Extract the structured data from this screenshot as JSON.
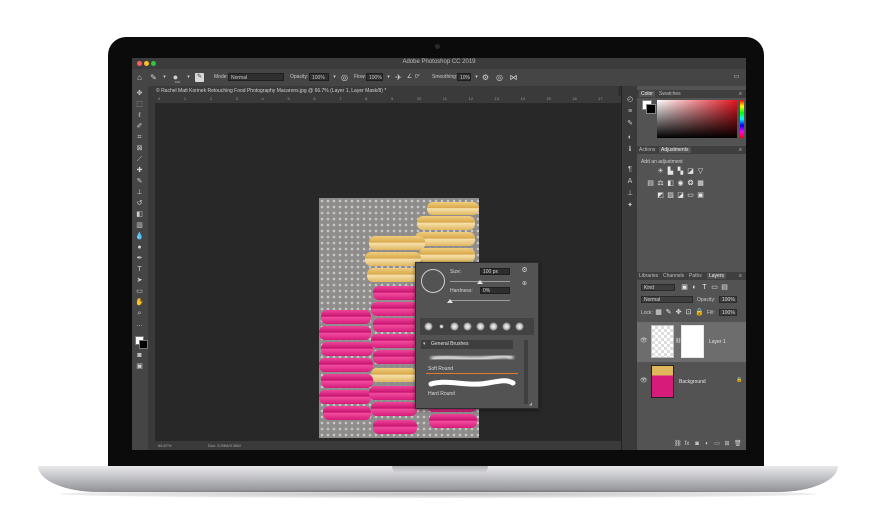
{
  "window": {
    "title": "Adobe Photoshop CC 2019"
  },
  "options_bar": {
    "brush_size": "100",
    "mode_label": "Mode:",
    "mode_value": "Normal",
    "opacity_label": "Opacity:",
    "opacity_value": "100%",
    "flow_label": "Flow:",
    "flow_value": "100%",
    "angle_value": "0°",
    "smoothing_label": "Smoothing:",
    "smoothing_value": "10%"
  },
  "document": {
    "tab_title": "© Rachel Matt Korinek Retouching Food Photography Macarons.jpg @ 66.7% (Layer 1, Layer Mask/8) *"
  },
  "ruler": {
    "ticks": [
      "0",
      "1",
      "2",
      "3",
      "4",
      "5",
      "6",
      "7",
      "8",
      "9",
      "10",
      "11",
      "12",
      "13",
      "14",
      "15",
      "16",
      "17"
    ]
  },
  "status": {
    "zoom": "66.67%",
    "doc": "Doc: 5.93M/9.35M"
  },
  "brush_popup": {
    "size_label": "Size:",
    "size_value": "100 px",
    "hardness_label": "Hardness:",
    "hardness_value": "0%",
    "folder": "General Brushes",
    "brushes": [
      "Soft Round",
      "Hard Round"
    ],
    "size_fraction": 0.5,
    "hardness_fraction": 0.0
  },
  "color_panel": {
    "tabs": [
      "Color",
      "Swatches"
    ],
    "active": "Color",
    "hue_color": "#e1141e"
  },
  "adjustments_panel": {
    "tabs": [
      "Actions",
      "Adjustments"
    ],
    "active": "Adjustments",
    "hint": "Add an adjustment"
  },
  "layers_panel": {
    "tabs": [
      "Libraries",
      "Channels",
      "Paths",
      "Layers"
    ],
    "active": "Layers",
    "filter": "Kind",
    "blend_mode": "Normal",
    "opacity_label": "Opacity:",
    "opacity_value": "100%",
    "lock_label": "Lock:",
    "fill_label": "Fill:",
    "fill_value": "100%",
    "layers": [
      {
        "name": "Layer 1",
        "selected": true
      },
      {
        "name": "Background",
        "selected": false
      }
    ]
  },
  "colors": {
    "pink": "#d71b7b",
    "yellow": "#e1b75e",
    "panel": "#535353",
    "canvas_bg": "#282828"
  }
}
